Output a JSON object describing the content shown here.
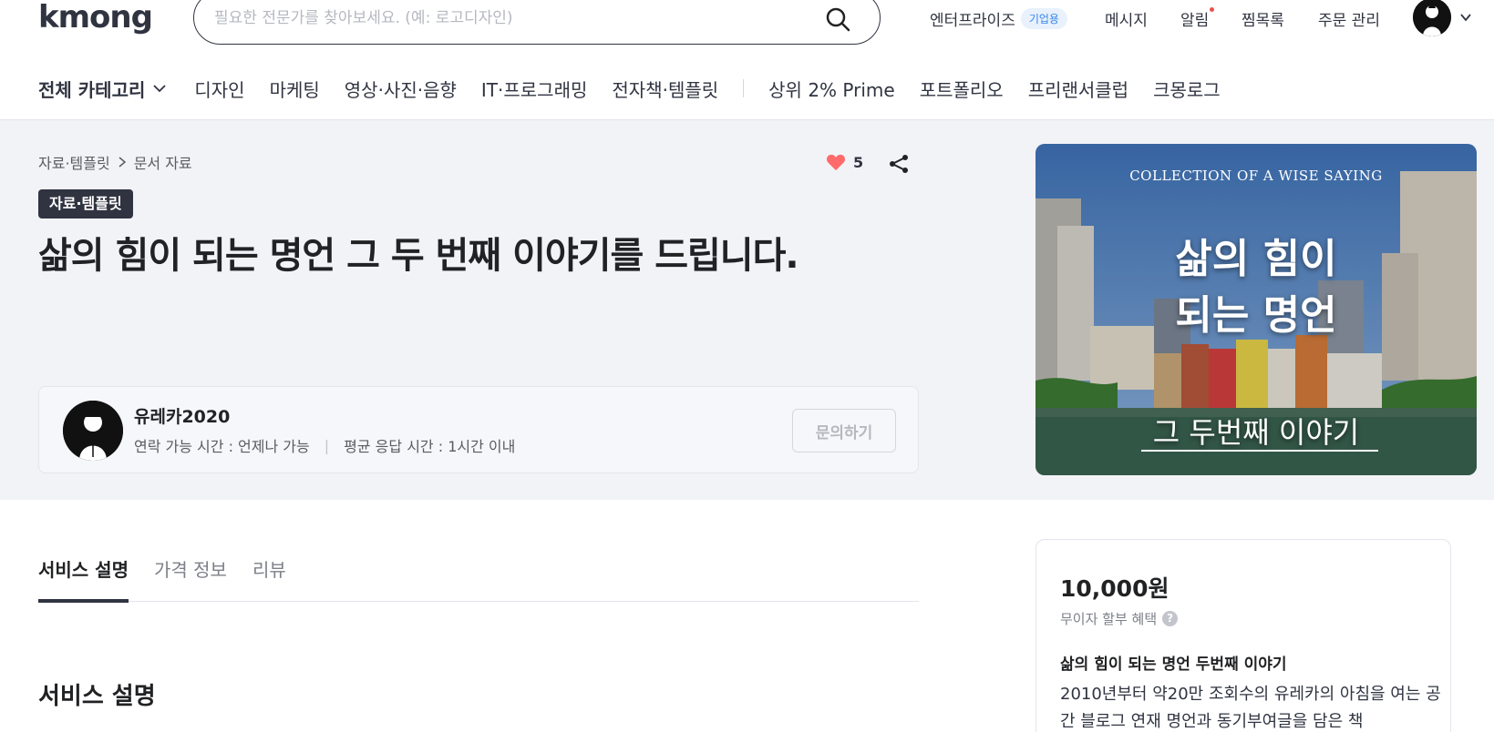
{
  "header": {
    "logo": "kmong",
    "search_placeholder": "필요한 전문가를 찾아보세요. (예: 로고디자인)",
    "nav": {
      "enterprise": "엔터프라이즈",
      "enterprise_badge": "기업용",
      "messages": "메시지",
      "alerts": "알림",
      "wishlist": "찜목록",
      "orders": "주문 관리"
    }
  },
  "categories": {
    "all": "전체 카테고리",
    "items": [
      "디자인",
      "마케팅",
      "영상·사진·음향",
      "IT·프로그래밍",
      "전자책·템플릿"
    ],
    "extra": [
      "상위 2% Prime",
      "포트폴리오",
      "프리랜서클럽",
      "크몽로그"
    ]
  },
  "hero": {
    "breadcrumb": [
      "자료·템플릿",
      "문서 자료"
    ],
    "like_count": "5",
    "tag": "자료·템플릿",
    "title": "삶의 힘이 되는 명언 그 두 번째 이야기를 드립니다."
  },
  "seller": {
    "name": "유레카2020",
    "contact_time": "연락 가능 시간 : 언제나 가능",
    "response_time": "평균 응답 시간 : 1시간 이내",
    "ask_label": "문의하기"
  },
  "thumbnail": {
    "top_text": "COLLECTION OF A WISE SAYING",
    "main_line1": "삶의 힘이",
    "main_line2": "되는 명언",
    "sub_text": "그 두번째 이야기"
  },
  "tabs": [
    "서비스 설명",
    "가격 정보",
    "리뷰"
  ],
  "section_title": "서비스 설명",
  "price_card": {
    "price": "10,000원",
    "installment": "무이자 할부 혜택",
    "package_title": "삶의 힘이 되는 명언 두번째 이야기",
    "package_desc": "2010년부터 약20만 조회수의 유레카의 아침을 여는 공간 블로그 연재 명언과 동기부여글을 담은 책"
  },
  "colors": {
    "brand_dark": "#303441",
    "heart": "#ff6b6b",
    "badge_blue": "#3a86e8"
  }
}
